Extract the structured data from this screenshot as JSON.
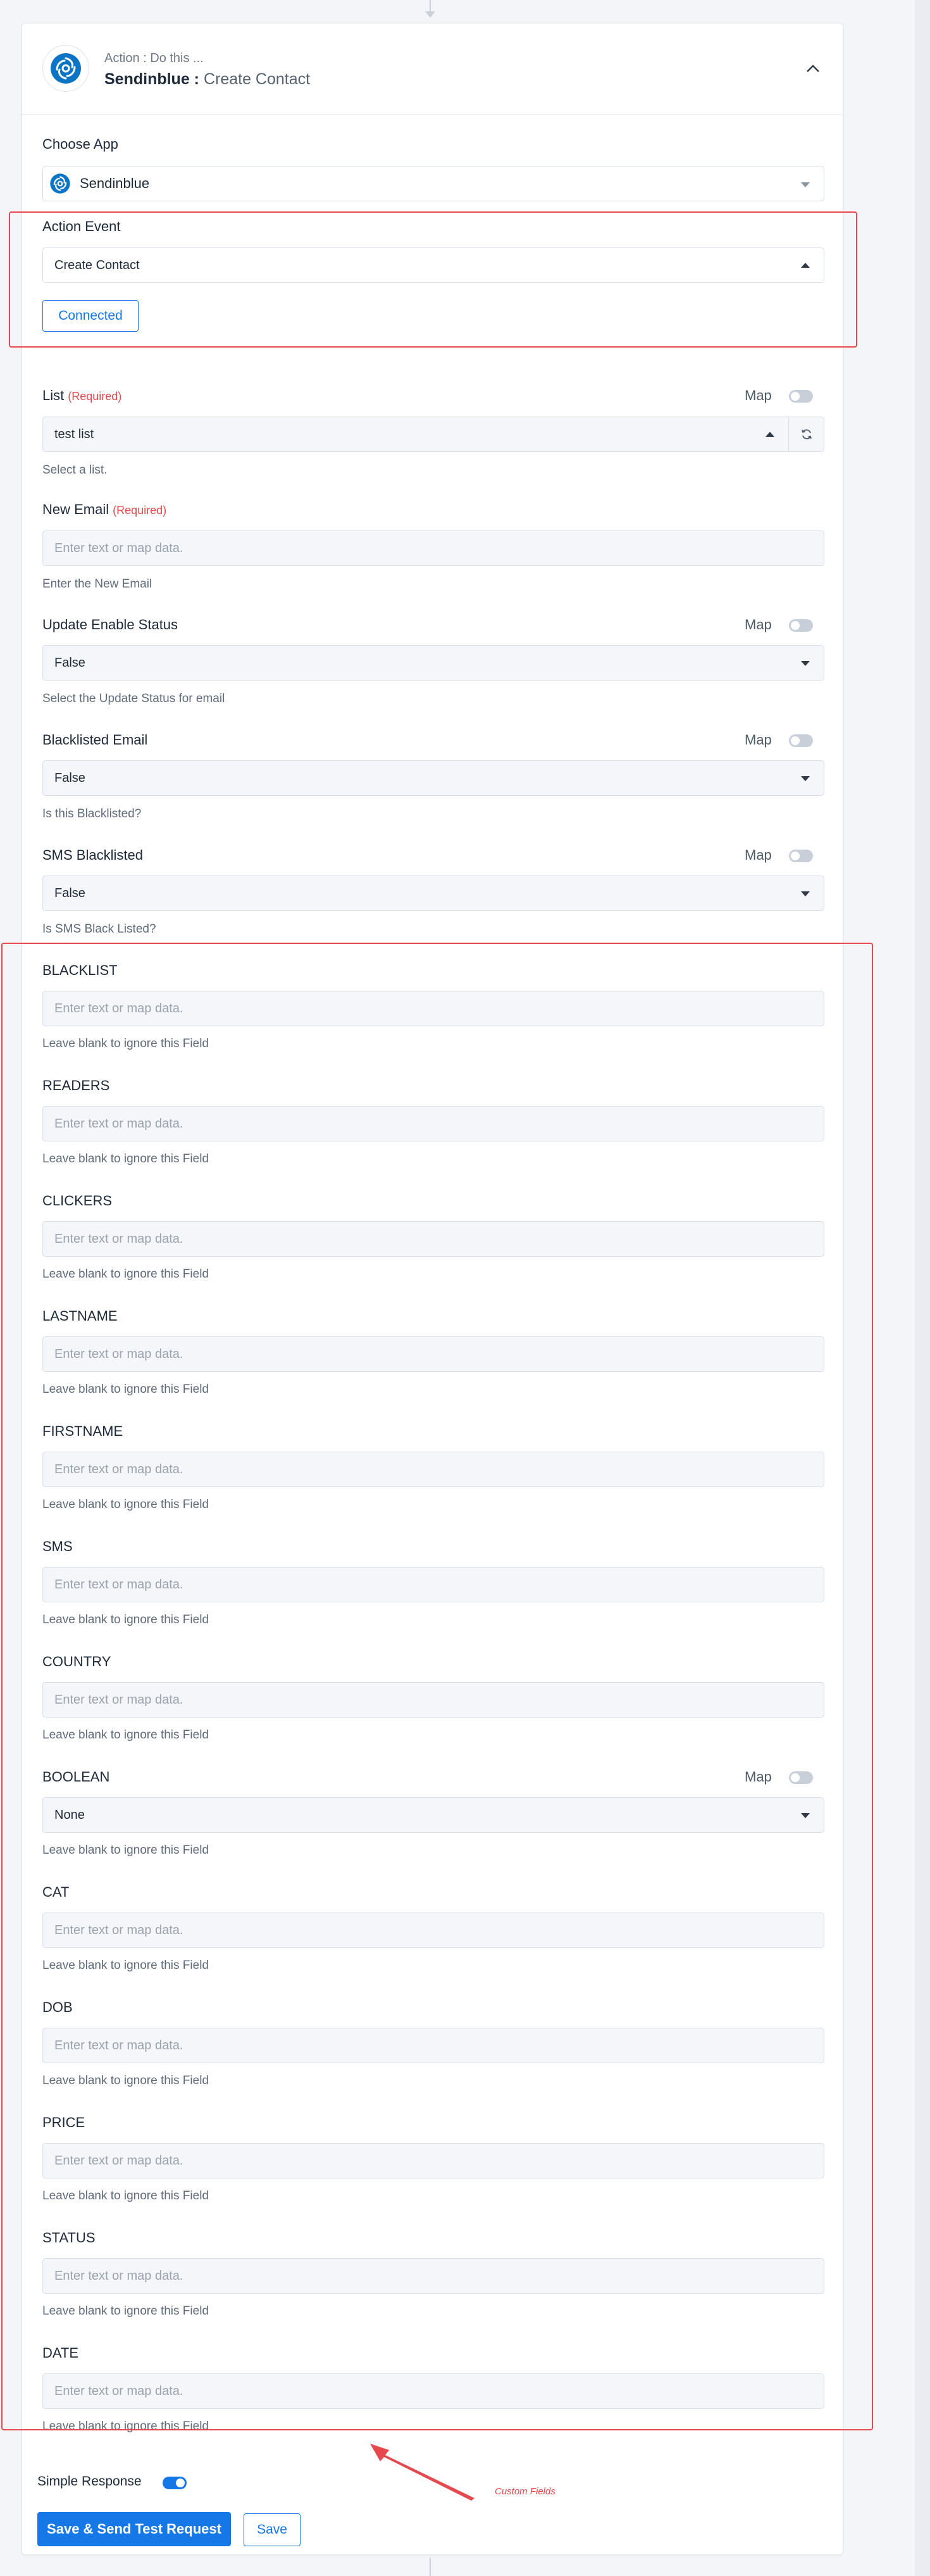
{
  "header": {
    "subtitle": "Action : Do this ...",
    "app_name": "Sendinblue :",
    "action_name": "Create Contact"
  },
  "choose_app": {
    "label": "Choose App",
    "value": "Sendinblue"
  },
  "action_event": {
    "label": "Action Event",
    "value": "Create Contact",
    "connected_label": "Connected"
  },
  "map_label": "Map",
  "required_label": "(Required)",
  "placeholder": "Enter text or map data.",
  "list_field": {
    "label": "List",
    "value": "test list",
    "hint": "Select a list."
  },
  "new_email": {
    "label": "New Email",
    "hint": "Enter the New Email"
  },
  "update_enable_status": {
    "label": "Update Enable Status",
    "value": "False",
    "hint": "Select the Update Status for email"
  },
  "blacklisted_email": {
    "label": "Blacklisted Email",
    "value": "False",
    "hint": "Is this Blacklisted?"
  },
  "sms_blacklisted": {
    "label": "SMS Blacklisted",
    "value": "False",
    "hint": "Is SMS Black Listed?"
  },
  "custom_hint": "Leave blank to ignore this Field",
  "custom_fields": {
    "blacklist": "BLACKLIST",
    "readers": "READERS",
    "clickers": "CLICKERS",
    "lastname": "LASTNAME",
    "firstname": "FIRSTNAME",
    "sms": "SMS",
    "country": "COUNTRY",
    "boolean": "BOOLEAN",
    "boolean_value": "None",
    "cat": "CAT",
    "dob": "DOB",
    "price": "PRICE",
    "status": "STATUS",
    "date": "DATE"
  },
  "footer": {
    "simple_response_label": "Simple Response",
    "save_send_label": "Save & Send Test Request",
    "save_label": "Save"
  },
  "annotation": {
    "text": "Custom Fields"
  },
  "colors": {
    "accent": "#1677e6",
    "highlight": "#e5484d"
  }
}
